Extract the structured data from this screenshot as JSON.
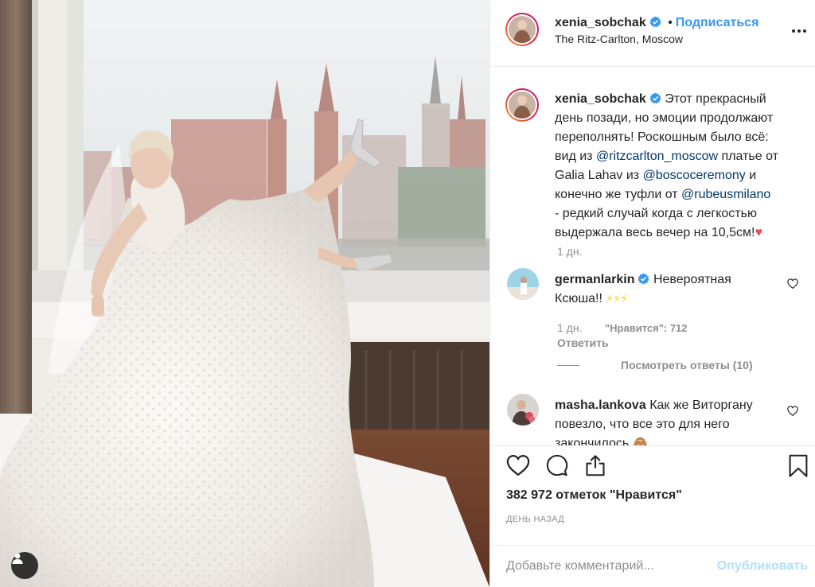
{
  "header": {
    "username": "xenia_sobchak",
    "dot": "•",
    "follow_label": "Подписаться",
    "location": "The Ritz-Carlton, Moscow"
  },
  "caption": {
    "username": "xenia_sobchak",
    "t1": "Этот прекрасный",
    "t2": "день позади, но эмоции продолжают",
    "t3": "переполнять! Роскошным было всё:",
    "t4a": "вид из ",
    "m1": "@ritzcarlton_moscow",
    "t4b": " платье от",
    "t5a": "Galia Lahav из ",
    "m2": "@boscoceremony",
    "t5b": " и",
    "t6a": "конечно же туфли от ",
    "m3": "@rubeusmilano",
    "t7": "- редкий случай когда с легкостью",
    "t8": "выдержала весь вечер на 10,5см!",
    "heart": "♥",
    "time": "1 дн."
  },
  "comments": [
    {
      "username": "germanlarkin",
      "verified": true,
      "text1": "Невероятная",
      "text2": "Ксюша!!",
      "emoji": "⚡⚡⚡",
      "time": "1 дн.",
      "likes": "\"Нравится\": 712",
      "reply_label": "Ответить",
      "view_replies": "Посмотреть ответы (10)"
    },
    {
      "username": "masha.lankova",
      "verified": false,
      "text1": "Как же Виторгану",
      "text2": "повезло, что все это для него",
      "text3": "закончилось",
      "emoji": "🙈"
    }
  ],
  "likes_count": "382 972 отметок \"Нравится\"",
  "date": "ДЕНЬ НАЗАД",
  "comment_input": {
    "placeholder": "Добавьте комментарий...",
    "value": ""
  },
  "publish_label": "Опубликовать",
  "colors": {
    "accent": "#3897f0",
    "verified": "#3897f0",
    "text": "#262626",
    "muted": "#8e8e8e",
    "publish_disabled": "#b2dffc",
    "heart": "#ed4956"
  }
}
